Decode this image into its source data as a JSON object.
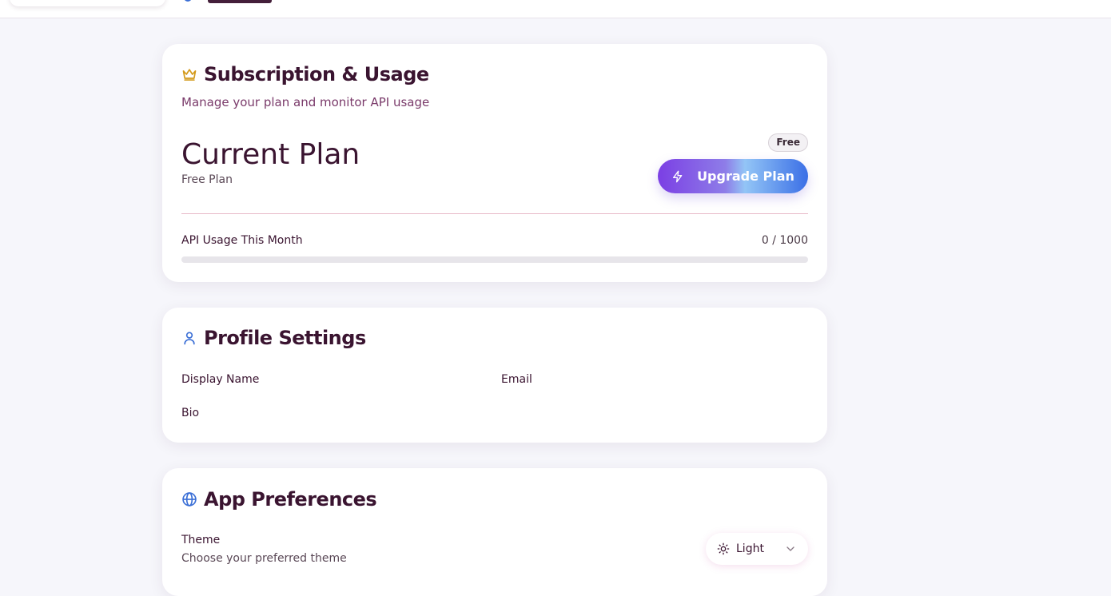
{
  "colors": {
    "accent": "#7b3fe4",
    "title": "#3a1430",
    "subtitle": "#7a3a6a",
    "crown_icon": "#d39a1a",
    "blue_icon": "#3b6fd6"
  },
  "subscription": {
    "icon": "crown-icon",
    "title": "Subscription & Usage",
    "subtitle": "Manage your plan and monitor API usage",
    "plan_heading": "Current Plan",
    "plan_name": "Free Plan",
    "plan_badge": "Free",
    "upgrade_label": "Upgrade Plan",
    "upgrade_icon": "lightning-icon",
    "usage_label": "API Usage This Month",
    "usage_value": "0 / 1000",
    "usage_used": 0,
    "usage_limit": 1000
  },
  "profile": {
    "icon": "user-icon",
    "title": "Profile Settings",
    "display_name_label": "Display Name",
    "email_label": "Email",
    "bio_label": "Bio"
  },
  "preferences": {
    "icon": "globe-icon",
    "title": "App Preferences",
    "theme_label": "Theme",
    "theme_description": "Choose your preferred theme",
    "theme_value": "Light",
    "theme_icon": "sun-icon"
  }
}
